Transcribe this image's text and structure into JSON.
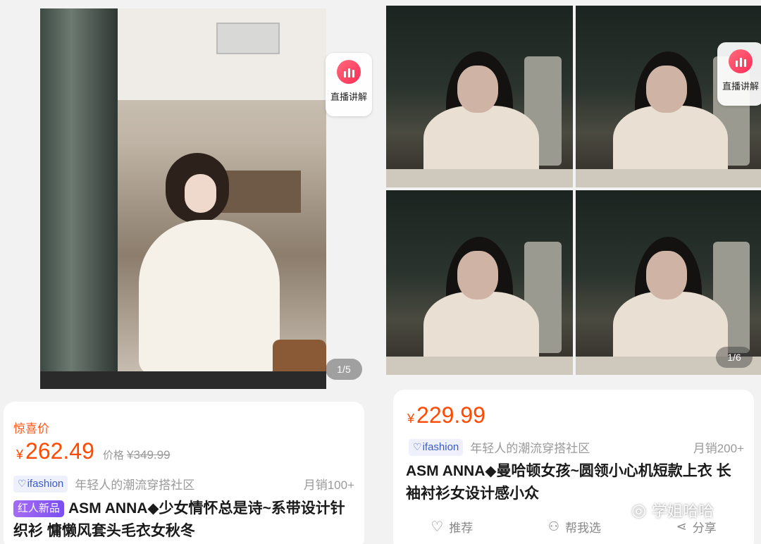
{
  "left": {
    "live_badge": "直播讲解",
    "pager": "1/5",
    "surprise_label": "惊喜价",
    "currency": "¥",
    "price": "262.49",
    "orig_label": "价格",
    "orig_price": "¥349.99",
    "brand": "ifashion",
    "slogan": "年轻人的潮流穿搭社区",
    "sales": "月销100+",
    "tag": "红人新品",
    "title": "ASM ANNA◆少女情怀总是诗~系带设计针织衫 慵懒风套头毛衣女秋冬"
  },
  "right": {
    "live_badge": "直播讲解",
    "pager": "1/6",
    "currency": "¥",
    "price": "229.99",
    "brand": "ifashion",
    "slogan": "年轻人的潮流穿搭社区",
    "sales": "月销200+",
    "title": "ASM ANNA◆曼哈顿女孩~圆领小心机短款上衣 长袖衬衫女设计感小众",
    "actions": {
      "recommend": "推荐",
      "help_choose": "帮我选",
      "share": "分享"
    }
  },
  "watermark": "学姐哈哈",
  "colors": {
    "price": "#ff4a00",
    "brand": "#3a5ac8",
    "tag": "#8b5cf6",
    "live": "#ff2d55"
  },
  "icons": [
    "heart-icon",
    "people-icon",
    "share-icon",
    "live-icon",
    "wechat-icon"
  ]
}
